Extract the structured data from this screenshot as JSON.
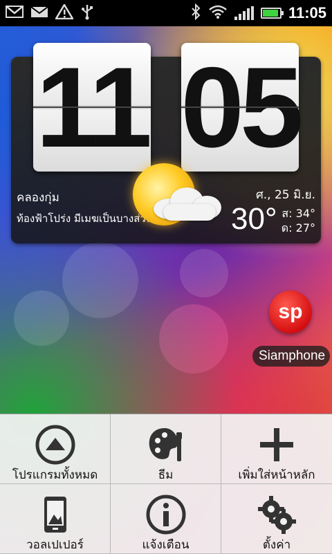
{
  "status_bar": {
    "time": "11:05",
    "battery_level": 0.85,
    "left_icons": [
      "gmail-icon",
      "mail-icon",
      "warning-icon",
      "usb-icon"
    ],
    "right_icons": [
      "bluetooth-icon",
      "wifi-icon",
      "signal-icon",
      "battery-icon"
    ]
  },
  "clock_widget": {
    "hours": "11",
    "minutes": "05",
    "location": "คลองกุ่ม",
    "condition": "ท้องฟ้าโปร่ง มีเมฆเป็นบางส่วน",
    "date": "ศ., 25 มิ.ย.",
    "temperature": "30°",
    "high": "ส: 34°",
    "low": "ด: 27°",
    "weather_icon": "partly-cloudy-icon"
  },
  "shortcut": {
    "icon_text": "sp",
    "label": "Siamphone"
  },
  "menu": {
    "items": [
      {
        "label": "โปรแกรมทั้งหมด",
        "icon": "all-apps-icon"
      },
      {
        "label": "ธีม",
        "icon": "palette-icon"
      },
      {
        "label": "เพิ่มใส่หน้าหลัก",
        "icon": "add-icon"
      },
      {
        "label": "วอลเปเปอร์",
        "icon": "wallpaper-icon"
      },
      {
        "label": "แจ้งเตือน",
        "icon": "info-icon"
      },
      {
        "label": "ตั้งค่า",
        "icon": "settings-icon"
      }
    ]
  },
  "colors": {
    "menu_bg": "#f2f2f2",
    "sp_red": "#d60f12",
    "battery_green": "#3fd13f"
  }
}
